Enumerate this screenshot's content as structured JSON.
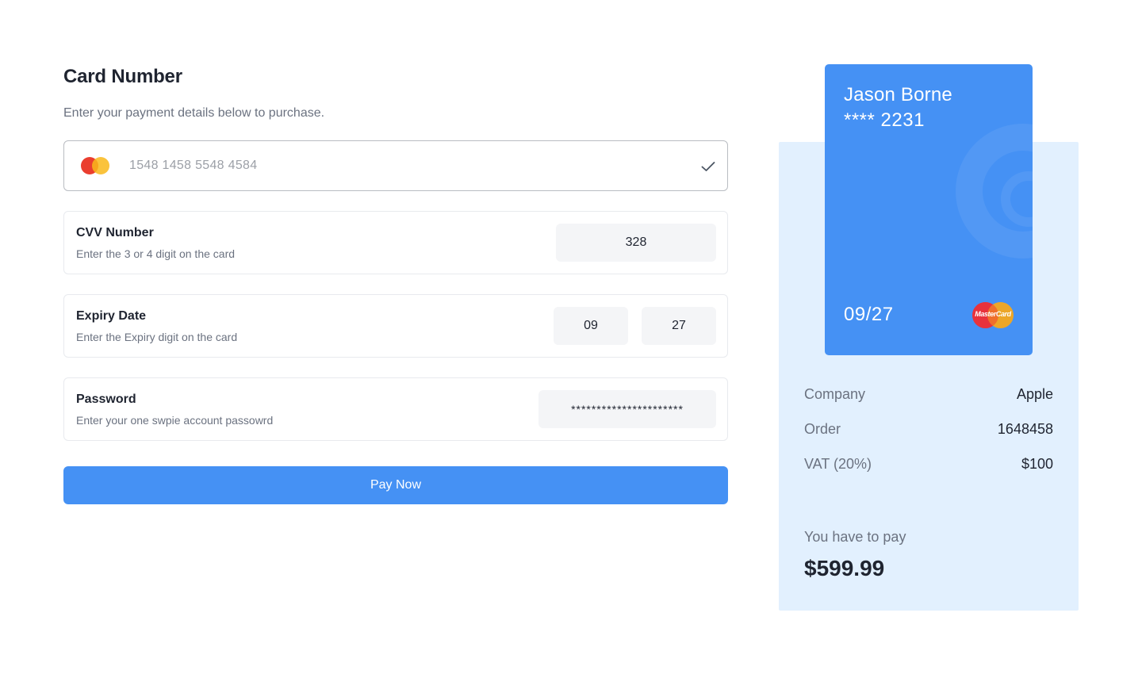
{
  "form": {
    "title": "Card Number",
    "subtitle": "Enter your payment details below to purchase.",
    "card_number": "1548 1458 5548 4584",
    "cvv": {
      "label": "CVV Number",
      "hint": "Enter the 3 or 4 digit on the card",
      "value": "328"
    },
    "expiry": {
      "label": "Expiry Date",
      "hint": "Enter the Expiry digit on the card",
      "month": "09",
      "year": "27"
    },
    "password": {
      "label": "Password",
      "hint": "Enter your one swpie account passowrd",
      "value": "**********************"
    },
    "pay_button": "Pay Now"
  },
  "credit_card": {
    "holder": "Jason Borne",
    "masked_number": "**** 2231",
    "expiry": "09/27",
    "brand_text": "MasterCard",
    "color": "#4591f4"
  },
  "summary": {
    "rows": [
      {
        "key": "Company",
        "value": "Apple"
      },
      {
        "key": "Order",
        "value": "1648458"
      },
      {
        "key": "VAT (20%)",
        "value": "$100"
      }
    ],
    "pay_label": "You have to pay",
    "pay_amount": "$599.99",
    "background": "#e2f0fe"
  },
  "icons": {
    "card_brand": "mastercard-icon",
    "valid": "check-icon"
  },
  "colors": {
    "accent": "#4591f4",
    "mastercard_red": "#ea3e2f",
    "mastercard_yellow": "#f9b81a"
  }
}
